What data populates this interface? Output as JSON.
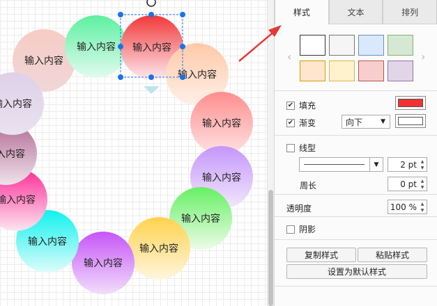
{
  "canvas": {
    "nodes": [
      {
        "label": "输入内容",
        "top": "#f7ccc6",
        "bottom": "#efd7d7"
      },
      {
        "label": "输入内容",
        "top": "#5cf0a0",
        "bottom": "#e3fbef"
      },
      {
        "label": "输入内容",
        "top": "#f23838",
        "bottom": "#fde9ef"
      },
      {
        "label": "输入内容",
        "top": "#ffc9a8",
        "bottom": "#fff0e8"
      },
      {
        "label": "输入内容",
        "top": "#ff8e8e",
        "bottom": "#ffe2e2"
      },
      {
        "label": "输入内容",
        "top": "#c596fb",
        "bottom": "#f1e8fd"
      },
      {
        "label": "输入内容",
        "top": "#66f064",
        "bottom": "#eefbe9"
      },
      {
        "label": "输入内容",
        "top": "#ffd24f",
        "bottom": "#fff6de"
      },
      {
        "label": "输入内容",
        "top": "#c655f8",
        "bottom": "#f1defa"
      },
      {
        "label": "输入内容",
        "top": "#10f2ee",
        "bottom": "#dffcfa"
      },
      {
        "label": "输入内容",
        "top": "#ff2c97",
        "bottom": "#fce5ef"
      },
      {
        "label": "输入内容",
        "top": "#b46d97",
        "bottom": "#eee2e9"
      },
      {
        "label": "输入内容",
        "top": "#dfd0e8",
        "bottom": "#e9e2ef"
      }
    ],
    "selection_color": "#1a73e8"
  },
  "panel": {
    "tabs": [
      "样式",
      "文本",
      "排列"
    ],
    "swatches": [
      {
        "fill": "#ffffff",
        "border": "#333333"
      },
      {
        "fill": "#f5f5f5",
        "border": "#777777"
      },
      {
        "fill": "#dae8fc",
        "border": "#6c8ebf"
      },
      {
        "fill": "#d5e8d4",
        "border": "#82b366"
      },
      {
        "fill": "#ffe6cc",
        "border": "#d79b00"
      },
      {
        "fill": "#fff2cc",
        "border": "#d6b656"
      },
      {
        "fill": "#f8cecc",
        "border": "#b85450"
      },
      {
        "fill": "#e1d5e7",
        "border": "#9673a6"
      }
    ],
    "fill_label": "填充",
    "fill_checked": true,
    "fill_color": "#f23232",
    "gradient_label": "渐变",
    "gradient_checked": true,
    "gradient_direction": "向下",
    "gradient_color": "#ffffff",
    "line_label": "线型",
    "line_checked": false,
    "line_width": "2 pt",
    "perimeter_label": "周长",
    "perimeter_value": "0 pt",
    "opacity_label": "透明度",
    "opacity_value": "100 %",
    "shadow_label": "阴影",
    "shadow_checked": false,
    "copy_style": "复制样式",
    "paste_style": "粘贴样式",
    "set_default_style": "设置为默认样式",
    "check_mark": "✔",
    "accent_color": "#e53935"
  }
}
